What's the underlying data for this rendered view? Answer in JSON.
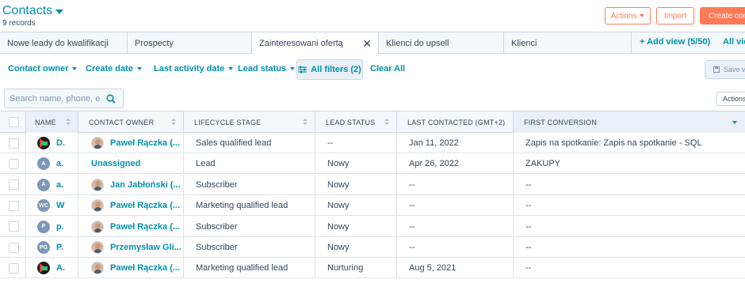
{
  "header": {
    "title": "Contacts",
    "records": "9 records",
    "actions_label": "Actions",
    "import_label": "Import",
    "create_label": "Create contact"
  },
  "tabs": [
    {
      "label": "Nowe leady do kwalifikacji"
    },
    {
      "label": "Prospecty"
    },
    {
      "label": "Zainteresowani ofertą"
    },
    {
      "label": "Klienci do upsell"
    },
    {
      "label": "Klienci"
    }
  ],
  "views": {
    "add_view": "+ Add view (5/50)",
    "all_views": "All views"
  },
  "filters": {
    "contact_owner": "Contact owner",
    "create_date": "Create date",
    "last_activity": "Last activity date",
    "lead_status": "Lead status",
    "all_filters": "All filters (2)",
    "clear_all": "Clear All",
    "save_view": "Save view"
  },
  "search": {
    "placeholder": "Search name, phone, e"
  },
  "table_actions": "Actions",
  "columns": {
    "name": "NAME",
    "owner": "CONTACT OWNER",
    "lifecycle": "LIFECYCLE STAGE",
    "lead_status": "LEAD STATUS",
    "last_contacted": "LAST CONTACTED (GMT+2)",
    "first_conversion": "FIRST CONVERSION"
  },
  "rows": [
    {
      "avatar": "logo",
      "initials": "",
      "name": "D.",
      "owner": "Paweł Rączka (...",
      "owner_photo": true,
      "lifecycle": "Sales qualified lead",
      "lead_status": "--",
      "last_contacted": "Jan 11, 2022",
      "first_conversion": "Zapis na spotkanie: Zapis na spotkanie - SQL"
    },
    {
      "avatar": "initials",
      "initials": "A",
      "name": "a.",
      "owner": "Unassigned",
      "owner_photo": false,
      "lifecycle": "Lead",
      "lead_status": "Nowy",
      "last_contacted": "Apr 26, 2022",
      "first_conversion": "ZAKUPY"
    },
    {
      "avatar": "initials",
      "initials": "A",
      "name": "a.",
      "owner": "Jan Jabłoński (...",
      "owner_photo": true,
      "lifecycle": "Subscriber",
      "lead_status": "Nowy",
      "last_contacted": "--",
      "first_conversion": "--"
    },
    {
      "avatar": "initials",
      "initials": "WC",
      "name": "W",
      "owner": "Paweł Rączka (...",
      "owner_photo": true,
      "lifecycle": "Marketing qualified lead",
      "lead_status": "Nowy",
      "last_contacted": "--",
      "first_conversion": "--"
    },
    {
      "avatar": "initials",
      "initials": "P",
      "name": "p.",
      "owner": "Paweł Rączka (...",
      "owner_photo": true,
      "lifecycle": "Subscriber",
      "lead_status": "Nowy",
      "last_contacted": "--",
      "first_conversion": "--"
    },
    {
      "avatar": "initials",
      "initials": "PG",
      "name": "P.",
      "owner": "Przemysław Gli...",
      "owner_photo": true,
      "lifecycle": "Subscriber",
      "lead_status": "Nowy",
      "last_contacted": "--",
      "first_conversion": "--"
    },
    {
      "avatar": "logo",
      "initials": "",
      "name": "A.",
      "owner": "Paweł Rączka (...",
      "owner_photo": true,
      "lifecycle": "Marketing qualified lead",
      "lead_status": "Nurturing",
      "last_contacted": "Aug 5, 2021",
      "first_conversion": "--"
    }
  ]
}
